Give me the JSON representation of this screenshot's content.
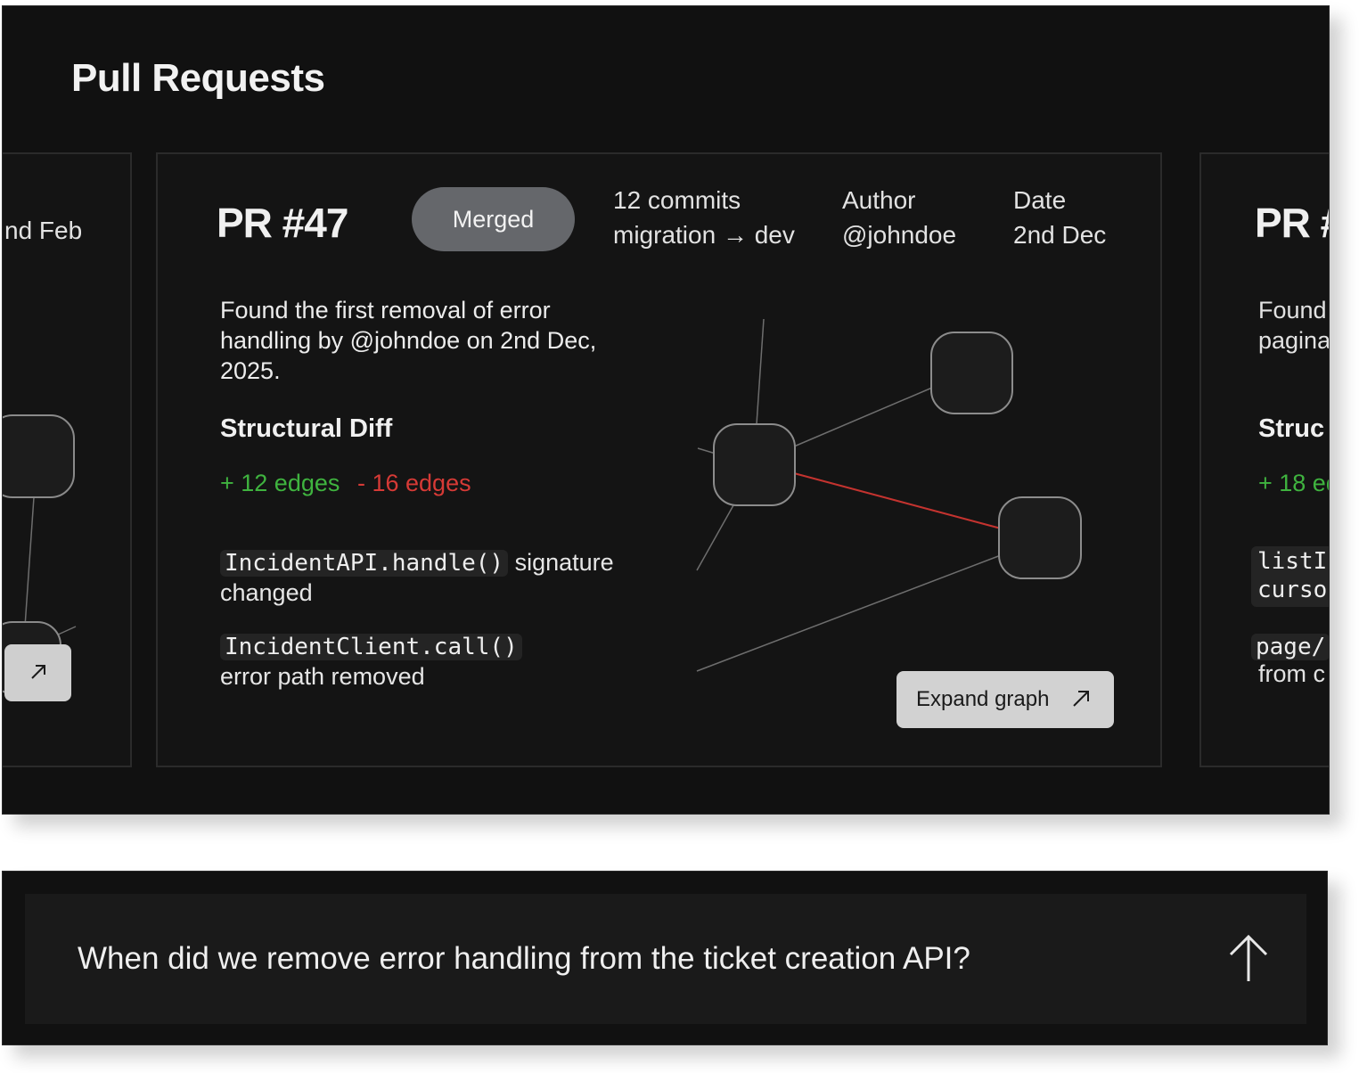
{
  "panel": {
    "title": "Pull Requests"
  },
  "cards": {
    "left": {
      "date_partial": "nd Feb"
    },
    "main": {
      "pr_number": "PR #47",
      "status": "Merged",
      "commits": "12 commits",
      "branch": "migration → dev",
      "author_label": "Author",
      "author": "@johndoe",
      "date_label": "Date",
      "date": "2nd Dec",
      "summary": "Found the first removal of error handling by @johndoe on 2nd Dec, 2025.",
      "diff_heading": "Structural Diff",
      "edges_added": "+ 12 edges",
      "edges_removed": "- 16 edges",
      "changes": [
        {
          "code": "IncidentAPI.handle()",
          "text": "signature changed"
        },
        {
          "code": "IncidentClient.call()",
          "text": "error path removed"
        }
      ],
      "expand_label": "Expand graph",
      "colors": {
        "added": "#3fb33f",
        "removed": "#d63a36"
      }
    },
    "right": {
      "pr_number": "PR #",
      "summary_line1": "Found",
      "summary_line2": "pagina",
      "diff_heading": "Struc",
      "edges_added": "+ 18 ed",
      "code1_line1": "listI",
      "code1_line2": "curso",
      "code2": "page/",
      "text2": "from c"
    }
  },
  "chat": {
    "placeholder": "When did we remove error handling from the ticket creation API?",
    "send_icon": "arrow-up-icon"
  }
}
